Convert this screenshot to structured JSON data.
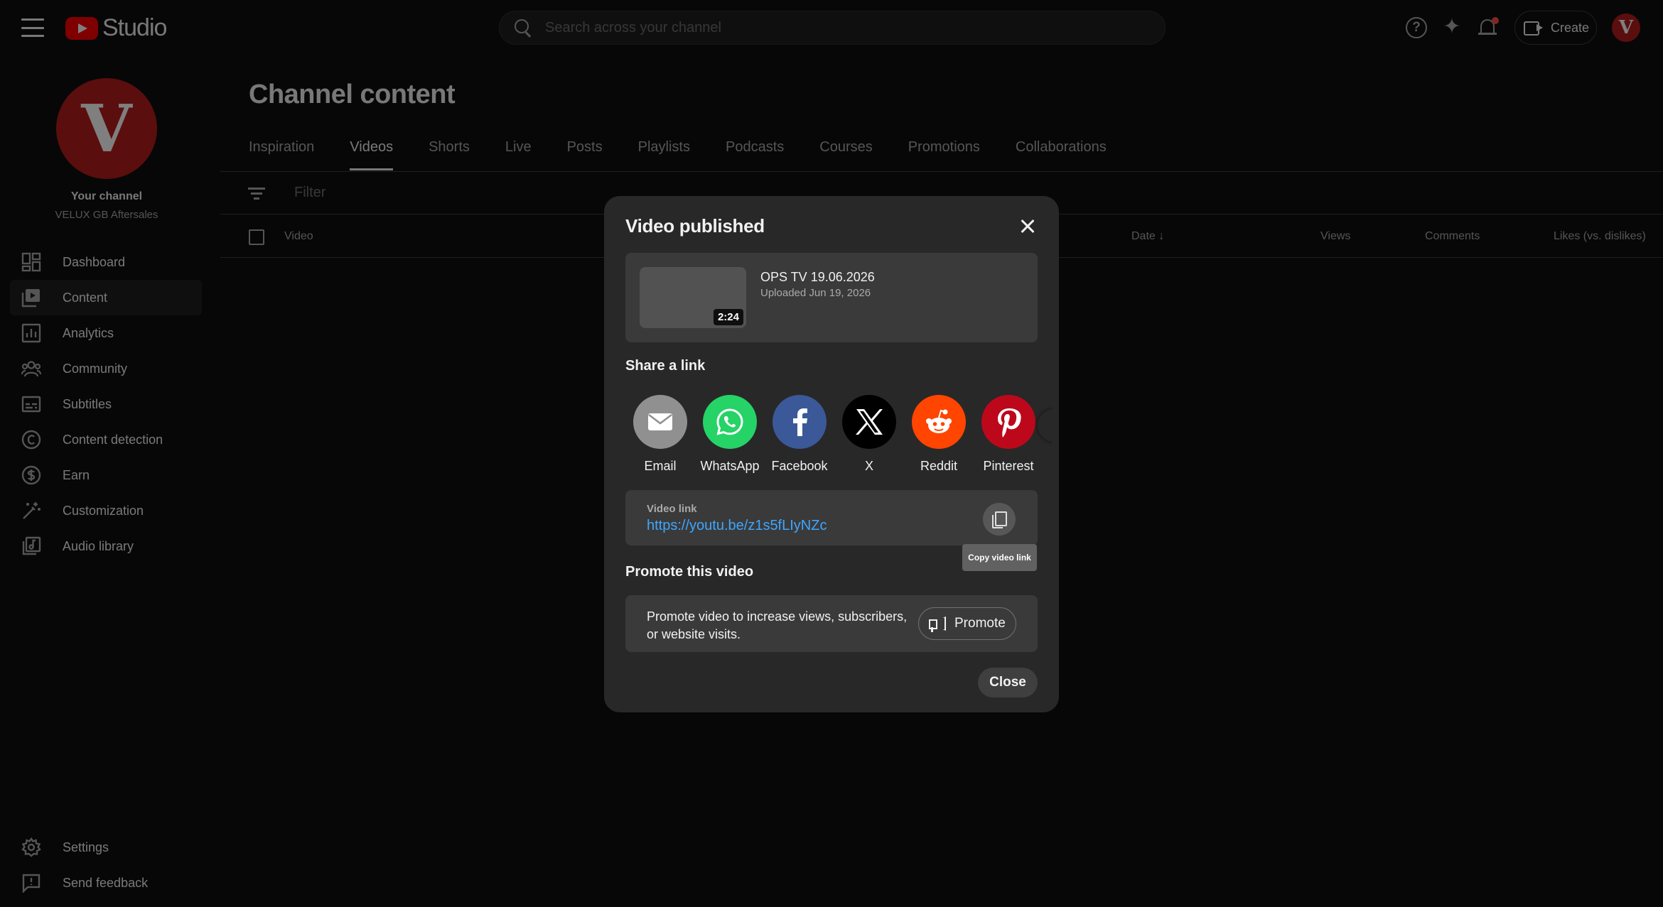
{
  "header": {
    "logo_text": "Studio",
    "search_placeholder": "Search across your channel",
    "create_label": "Create",
    "avatar_letter": "V"
  },
  "sidebar": {
    "avatar_letter": "V",
    "channel_title": "Your channel",
    "channel_name": "VELUX GB Aftersales",
    "items": [
      {
        "label": "Dashboard",
        "icon": "dashboard-icon"
      },
      {
        "label": "Content",
        "icon": "content-icon",
        "active": true
      },
      {
        "label": "Analytics",
        "icon": "analytics-icon"
      },
      {
        "label": "Community",
        "icon": "community-icon"
      },
      {
        "label": "Subtitles",
        "icon": "subtitles-icon"
      },
      {
        "label": "Content detection",
        "icon": "copyright-icon"
      },
      {
        "label": "Earn",
        "icon": "dollar-icon"
      },
      {
        "label": "Customization",
        "icon": "magic-wand-icon"
      },
      {
        "label": "Audio library",
        "icon": "audio-library-icon"
      }
    ],
    "bottom_items": [
      {
        "label": "Settings",
        "icon": "gear-icon"
      },
      {
        "label": "Send feedback",
        "icon": "feedback-icon"
      }
    ]
  },
  "main": {
    "title": "Channel content",
    "tabs": [
      "Inspiration",
      "Videos",
      "Shorts",
      "Live",
      "Posts",
      "Playlists",
      "Podcasts",
      "Courses",
      "Promotions",
      "Collaborations"
    ],
    "active_tab": "Videos",
    "filter_placeholder": "Filter",
    "columns": {
      "video": "Video",
      "date": "Date",
      "views": "Views",
      "comments": "Comments",
      "likes": "Likes (vs. dislikes)"
    }
  },
  "dialog": {
    "title": "Video published",
    "video": {
      "duration": "2:24",
      "title": "OPS TV 19.06.2026",
      "uploaded": "Uploaded Jun 19, 2026"
    },
    "share_heading": "Share a link",
    "share_targets": [
      {
        "label": "Email",
        "color": "#909090",
        "icon": "email-icon"
      },
      {
        "label": "WhatsApp",
        "color": "#25d366",
        "icon": "whatsapp-icon"
      },
      {
        "label": "Facebook",
        "color": "#3b5998",
        "icon": "facebook-icon"
      },
      {
        "label": "X",
        "color": "#000000",
        "icon": "x-icon"
      },
      {
        "label": "Reddit",
        "color": "#ff4500",
        "icon": "reddit-icon"
      },
      {
        "label": "Pinterest",
        "color": "#bd081c",
        "icon": "pinterest-icon"
      }
    ],
    "link_label": "Video link",
    "link_url": "https://youtu.be/z1s5fLIyNZc",
    "copy_tooltip": "Copy video link",
    "promote_heading": "Promote this video",
    "promote_text": "Promote video to increase views, subscribers, or website visits.",
    "promote_button": "Promote",
    "close_button": "Close"
  }
}
